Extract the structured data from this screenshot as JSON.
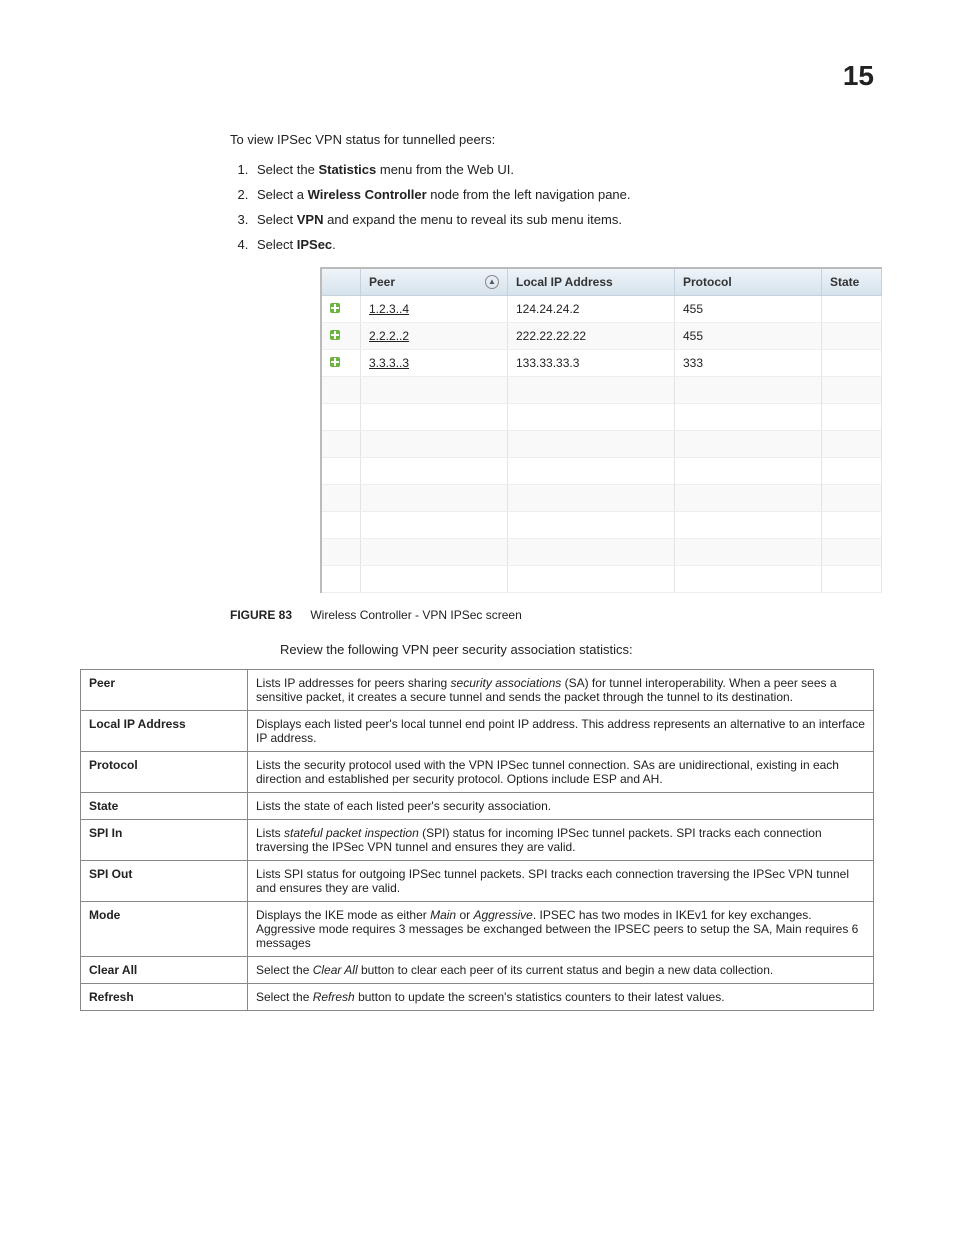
{
  "page_number": "15",
  "intro": "To view IPSec VPN status for tunnelled peers:",
  "steps": [
    {
      "prefix": "Select the ",
      "bold": "Statistics",
      "suffix": " menu from the Web UI."
    },
    {
      "prefix": "Select a ",
      "bold": "Wireless Controller",
      "suffix": " node from the left navigation pane."
    },
    {
      "prefix": "Select ",
      "bold": "VPN",
      "suffix": " and expand the menu to reveal its sub menu items."
    },
    {
      "prefix": "Select ",
      "bold": "IPSec",
      "suffix": "."
    }
  ],
  "screenshot_table": {
    "headers": [
      "Peer",
      "Local IP Address",
      "Protocol",
      "State"
    ],
    "rows": [
      {
        "peer": "1.2.3..4",
        "local": "124.24.24.2",
        "protocol": "455",
        "state": ""
      },
      {
        "peer": "2.2.2..2",
        "local": "222.22.22.22",
        "protocol": "455",
        "state": ""
      },
      {
        "peer": "3.3.3..3",
        "local": "133.33.33.3",
        "protocol": "333",
        "state": ""
      }
    ],
    "empty_rows": 8
  },
  "figure": {
    "label": "FIGURE 83",
    "caption": "Wireless Controller - VPN IPSec screen"
  },
  "review_text": "Review the following VPN peer security association statistics:",
  "definitions": [
    {
      "term": "Peer",
      "desc_parts": [
        {
          "text": "Lists IP addresses for peers sharing "
        },
        {
          "text": "security associations",
          "italic": true
        },
        {
          "text": " (SA) for tunnel interoperability. When a peer sees a sensitive packet, it creates a secure tunnel and sends the packet through the tunnel to its destination."
        }
      ]
    },
    {
      "term": "Local IP Address",
      "desc_parts": [
        {
          "text": "Displays each listed peer's local tunnel end point IP address. This address represents an alternative to an interface IP address."
        }
      ]
    },
    {
      "term": "Protocol",
      "desc_parts": [
        {
          "text": "Lists the security protocol used with the VPN IPSec tunnel connection. SAs are unidirectional, existing in each direction and established per security protocol. Options include ESP and AH."
        }
      ]
    },
    {
      "term": "State",
      "desc_parts": [
        {
          "text": "Lists the state of each listed peer's security association."
        }
      ]
    },
    {
      "term": "SPI In",
      "desc_parts": [
        {
          "text": "Lists "
        },
        {
          "text": "stateful packet inspection",
          "italic": true
        },
        {
          "text": " (SPI) status for incoming IPSec tunnel packets. SPI tracks each connection traversing the IPSec VPN tunnel and ensures they are valid."
        }
      ]
    },
    {
      "term": "SPI Out",
      "desc_parts": [
        {
          "text": "Lists SPI status for outgoing IPSec tunnel packets. SPI tracks each connection traversing the IPSec VPN tunnel and ensures they are valid."
        }
      ]
    },
    {
      "term": "Mode",
      "desc_parts": [
        {
          "text": "Displays the IKE mode as either "
        },
        {
          "text": "Main",
          "italic": true
        },
        {
          "text": " or "
        },
        {
          "text": "Aggressive",
          "italic": true
        },
        {
          "text": ". IPSEC has two modes in IKEv1 for key exchanges. Aggressive mode requires 3 messages be exchanged between the IPSEC peers to setup the SA, Main requires 6 messages"
        }
      ]
    },
    {
      "term": "Clear All",
      "desc_parts": [
        {
          "text": "Select the "
        },
        {
          "text": "Clear All",
          "italic": true
        },
        {
          "text": " button to clear each peer of its current status and begin a new data collection."
        }
      ]
    },
    {
      "term": "Refresh",
      "desc_parts": [
        {
          "text": "Select the "
        },
        {
          "text": "Refresh",
          "italic": true
        },
        {
          "text": " button to update the screen's statistics counters to their latest values."
        }
      ]
    }
  ]
}
